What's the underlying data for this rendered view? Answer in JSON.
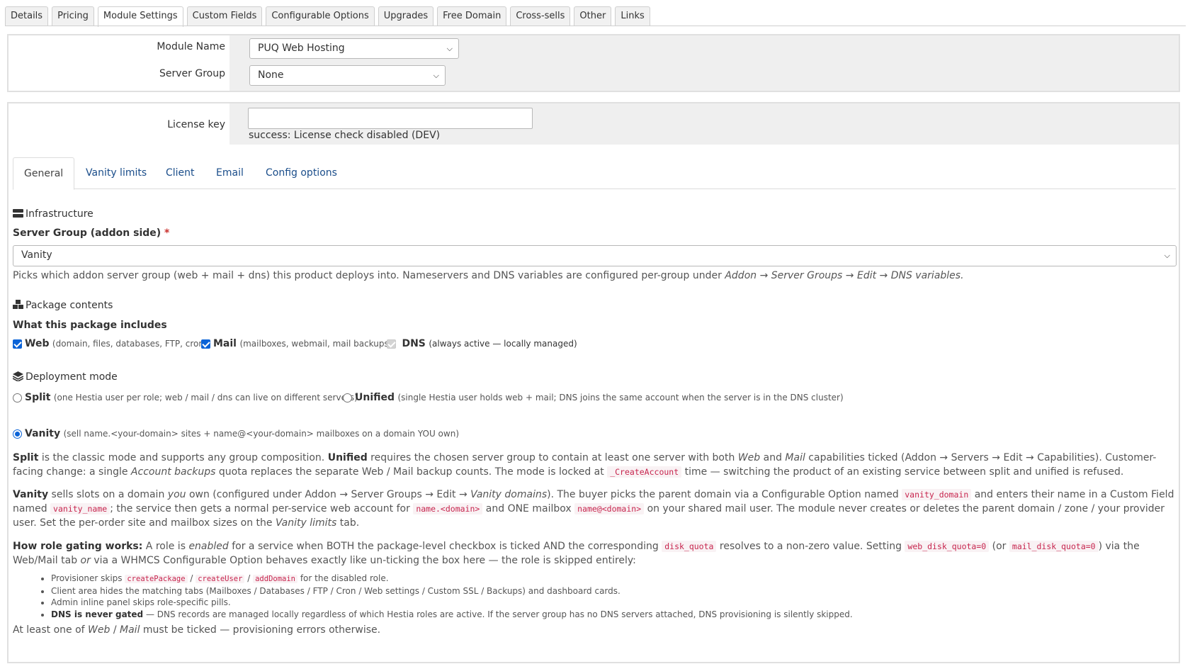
{
  "top_tabs": [
    "Details",
    "Pricing",
    "Module Settings",
    "Custom Fields",
    "Configurable Options",
    "Upgrades",
    "Free Domain",
    "Cross-sells",
    "Other",
    "Links"
  ],
  "module": {
    "module_name_label": "Module Name",
    "module_name_value": "PUQ Web Hosting",
    "server_group_label": "Server Group",
    "server_group_value": "None"
  },
  "license": {
    "label": "License key",
    "value": "",
    "status": "success: License check disabled (DEV)"
  },
  "sub_tabs": [
    "General",
    "Vanity limits",
    "Client",
    "Email",
    "Config options"
  ],
  "infrastructure": {
    "heading": "Infrastructure",
    "field_label": "Server Group (addon side)",
    "required_mark": "*",
    "select_value": "Vanity",
    "help_pre": "Picks which addon server group (web + mail + dns) this product deploys into. Nameservers and DNS variables are configured per-group under ",
    "help_path": "Addon → Server Groups → Edit → DNS variables."
  },
  "package": {
    "heading": "Package contents",
    "includes_label": "What this package includes",
    "web_label": "Web",
    "web_note": "(domain, files, databases, FTP, cron)",
    "mail_label": "Mail",
    "mail_note": "(mailboxes, webmail, mail backups)",
    "dns_label": "DNS",
    "dns_note": "(always active — locally managed)"
  },
  "deployment": {
    "heading": "Deployment mode",
    "split_label": "Split",
    "split_note": "(one Hestia user per role; web / mail / dns can live on different servers)",
    "unified_label": "Unified",
    "unified_note": "(single Hestia user holds web + mail; DNS joins the same account when the server is in the DNS cluster)",
    "vanity_label": "Vanity",
    "vanity_note": "(sell name.<your-domain> sites + name@<your-domain> mailboxes on a domain YOU own)"
  },
  "para1": {
    "t1": "Split",
    "t2": " is the classic mode and supports any group composition. ",
    "t3": "Unified",
    "t4": " requires the chosen server group to contain at least one server with both ",
    "t5": "Web",
    "t6": " and ",
    "t7": "Mail",
    "t8": " capabilities ticked (Addon → Servers → Edit → Capabilities). Customer-facing change: a single ",
    "t9": "Account backups",
    "t10": " quota replaces the separate Web / Mail backup counts. The mode is locked at ",
    "c1": "_CreateAccount",
    "t11": " time — switching the product of an existing service between split and unified is refused."
  },
  "para2": {
    "t1": "Vanity",
    "t2": " sells slots on a domain ",
    "t3": "you",
    "t4": " own (configured under Addon → Server Groups → Edit → ",
    "t5": "Vanity domains",
    "t6": "). The buyer picks the parent domain via a Configurable Option named ",
    "c1": "vanity_domain",
    "t7": " and enters their name in a Custom Field named ",
    "c2": "vanity_name",
    "t8": "; the service then gets a normal per-service web account for ",
    "c3": "name.<domain>",
    "t9": " and ONE mailbox ",
    "c4": "name@<domain>",
    "t10": " on your shared mail user. The module never creates or deletes the parent domain / zone / your provider user. Set the per-order site and mailbox sizes on the ",
    "t11": "Vanity limits",
    "t12": " tab."
  },
  "para3": {
    "t1": "How role gating works:",
    "t2": " A role is ",
    "t3": "enabled",
    "t4": " for a service when BOTH the package-level checkbox is ticked AND the corresponding ",
    "c1": "disk_quota",
    "t5": " resolves to a non-zero value. Setting ",
    "c2": "web_disk_quota=0",
    "t6": " (or ",
    "c3": "mail_disk_quota=0",
    "t7": ") via the Web/Mail tab ",
    "t8": "or",
    "t9": " via a WHMCS Configurable Option behaves exactly like un-ticking the box here — the role is skipped entirely:"
  },
  "bullets": {
    "b1_pre": "Provisioner skips ",
    "b1_c1": "createPackage",
    "b1_sep1": " / ",
    "b1_c2": "createUser",
    "b1_sep2": " / ",
    "b1_c3": "addDomain",
    "b1_post": " for the disabled role.",
    "b2": "Client area hides the matching tabs (Mailboxes / Databases / FTP / Cron / Web settings / Custom SSL / Backups) and dashboard cards.",
    "b3": "Admin inline panel skips role-specific pills.",
    "b4_bold": "DNS is never gated",
    "b4_rest": " — DNS records are managed locally regardless of which Hestia roles are active. If the server group has no DNS servers attached, DNS provisioning is silently skipped."
  },
  "footer_note": {
    "t1": "At least one of ",
    "t2": "Web",
    "t3": " / ",
    "t4": "Mail",
    "t5": " must be ticked — provisioning errors otherwise."
  }
}
